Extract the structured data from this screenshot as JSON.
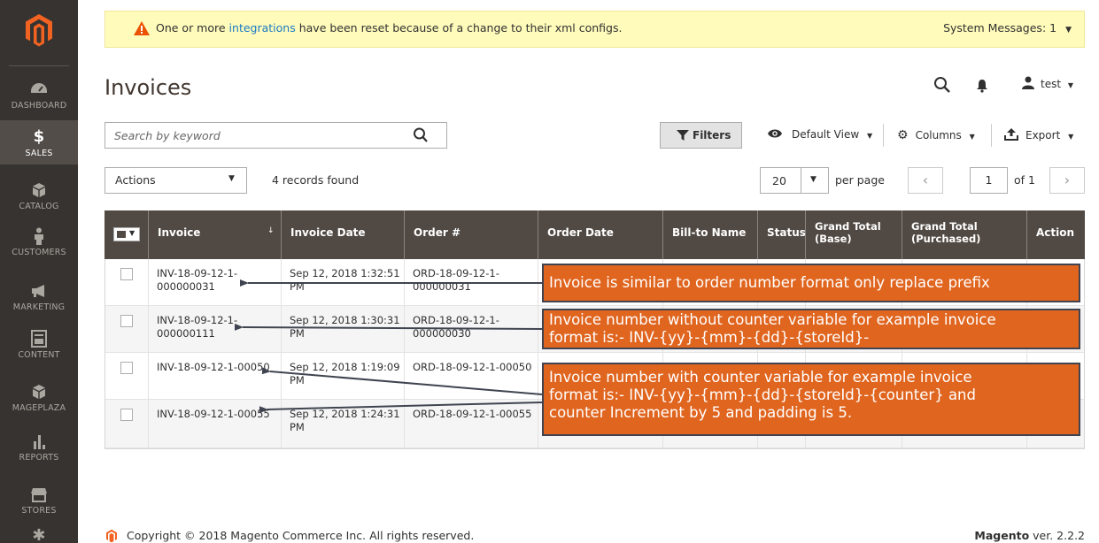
{
  "sidebar": {
    "items": [
      {
        "label": "DASHBOARD",
        "icon": "dashboard-icon"
      },
      {
        "label": "SALES",
        "icon": "dollar-icon"
      },
      {
        "label": "CATALOG",
        "icon": "box-icon"
      },
      {
        "label": "CUSTOMERS",
        "icon": "person-icon"
      },
      {
        "label": "MARKETING",
        "icon": "megaphone-icon"
      },
      {
        "label": "CONTENT",
        "icon": "layout-icon"
      },
      {
        "label": "MAGEPLAZA",
        "icon": "box-icon"
      },
      {
        "label": "REPORTS",
        "icon": "bar-chart-icon"
      },
      {
        "label": "STORES",
        "icon": "store-icon"
      }
    ]
  },
  "notice": {
    "before": "One or more ",
    "link": "integrations",
    "after": " have been reset because of a change to their xml configs.",
    "system": "System Messages: 1"
  },
  "header": {
    "title": "Invoices",
    "user": "test"
  },
  "toolbar": {
    "search_placeholder": "Search by keyword",
    "filters": "Filters",
    "view": "Default View",
    "columns": "Columns",
    "export": "Export",
    "actions": "Actions",
    "records": "4 records found",
    "per_page_value": "20",
    "per_page_label": "per page",
    "page": "1",
    "of": "of 1"
  },
  "grid": {
    "columns": [
      "Invoice",
      "Invoice Date",
      "Order #",
      "Order Date",
      "Bill-to Name",
      "Status",
      "Grand Total (Base)",
      "Grand Total (Purchased)",
      "Action"
    ],
    "rows": [
      {
        "invoice": "INV-18-09-12-1-000000031",
        "invoice_date": "Sep 12, 2018 1:32:51 PM",
        "order": "ORD-18-09-12-1-000000031"
      },
      {
        "invoice": "INV-18-09-12-1-000000111",
        "invoice_date": "Sep 12, 2018 1:30:31 PM",
        "order": "ORD-18-09-12-1-000000030"
      },
      {
        "invoice": "INV-18-09-12-1-00050",
        "invoice_date": "Sep 12, 2018 1:19:09 PM",
        "order": "ORD-18-09-12-1-00050"
      },
      {
        "invoice": "INV-18-09-12-1-00055",
        "invoice_date": "Sep 12, 2018 1:24:31 PM",
        "order": "ORD-18-09-12-1-00055"
      }
    ]
  },
  "callouts": [
    {
      "text": "Invoice is similar to order number format only replace prefix"
    },
    {
      "line1": "Invoice number without counter variable for example invoice",
      "line2": "format is:- INV-{yy}-{mm}-{dd}-{storeId}-"
    },
    {
      "line1": "Invoice number with counter variable for example invoice",
      "line2": "format is:- INV-{yy}-{mm}-{dd}-{storeId}-{counter} and",
      "line3": "counter Increment by 5 and padding is 5."
    }
  ],
  "footer": {
    "copyright": "Copyright © 2018 Magento Commerce Inc. All rights reserved.",
    "brand": "Magento",
    "version": " ver. 2.2.2"
  },
  "colors": {
    "sidebar": "#373330",
    "header": "#514943",
    "callout": "#e0651f",
    "notice": "#fffbbb",
    "link": "#1979c3"
  }
}
